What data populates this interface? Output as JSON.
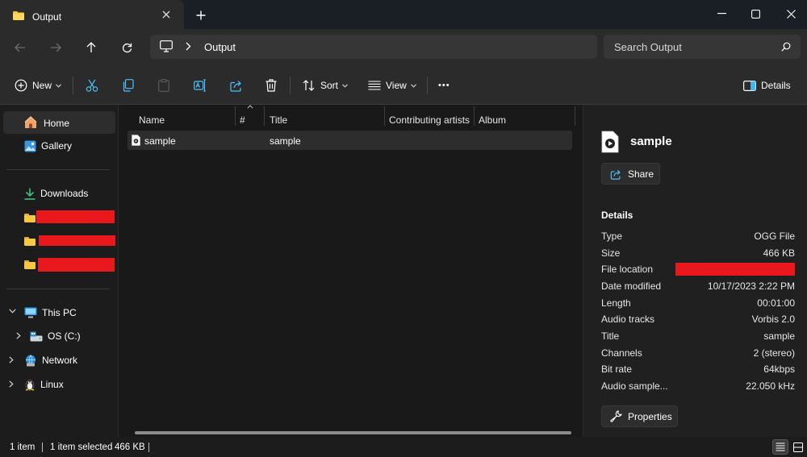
{
  "window": {
    "tab_title": "Output",
    "new_tab_symbol": "+"
  },
  "address": {
    "path": "Output",
    "search_placeholder": "Search Output"
  },
  "toolbar": {
    "new_label": "New",
    "sort_label": "Sort",
    "view_label": "View",
    "more_symbol": "•••",
    "details_label": "Details"
  },
  "nav": {
    "home": "Home",
    "gallery": "Gallery",
    "downloads": "Downloads",
    "this_pc": "This PC",
    "os_drive": "OS (C:)",
    "network": "Network",
    "linux": "Linux"
  },
  "columns": {
    "name": "Name",
    "number": "#",
    "title": "Title",
    "contributing_artists": "Contributing artists",
    "album": "Album"
  },
  "files": [
    {
      "name": "sample",
      "title": "sample"
    }
  ],
  "details_pane": {
    "file_name": "sample",
    "share_label": "Share",
    "heading": "Details",
    "properties_label": "Properties",
    "props": [
      {
        "key": "Type",
        "value": "OGG File"
      },
      {
        "key": "Size",
        "value": "466 KB"
      },
      {
        "key": "File location",
        "value": ""
      },
      {
        "key": "Date modified",
        "value": "10/17/2023 2:22 PM"
      },
      {
        "key": "Length",
        "value": "00:01:00"
      },
      {
        "key": "Audio tracks",
        "value": "Vorbis 2.0"
      },
      {
        "key": "Title",
        "value": "sample"
      },
      {
        "key": "Channels",
        "value": "2 (stereo)"
      },
      {
        "key": "Bit rate",
        "value": "64kbps"
      },
      {
        "key": "Audio sample...",
        "value": "22.050 kHz"
      }
    ]
  },
  "status": {
    "item_count": "1 item",
    "selection": "1 item selected",
    "size": "466 KB"
  },
  "colors": {
    "accent_folder": "#f8c844",
    "redaction": "#e8181d",
    "background": "#1c1c1c"
  }
}
